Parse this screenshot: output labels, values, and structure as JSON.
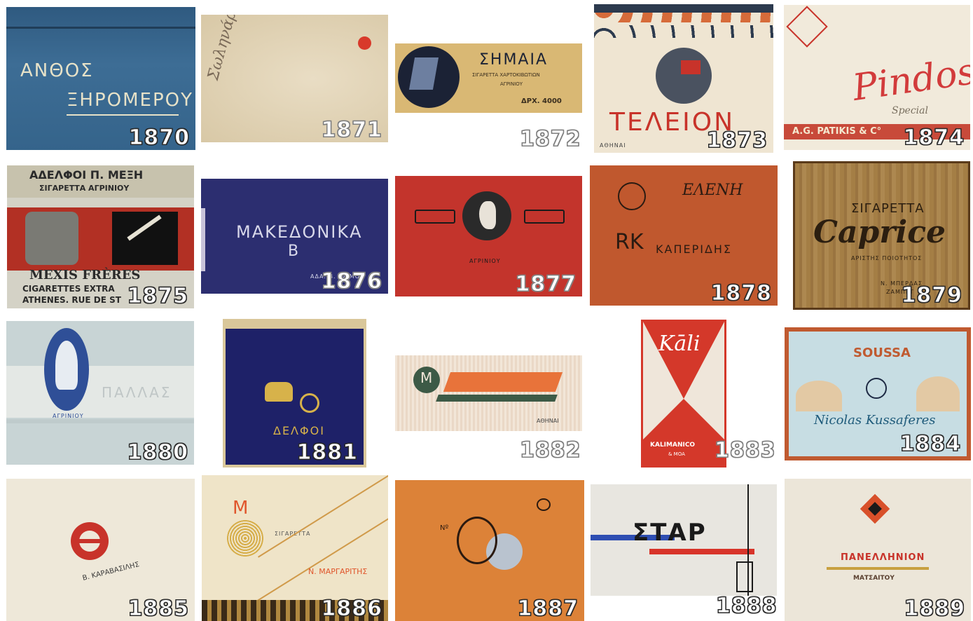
{
  "cards": [
    {
      "year": "1870",
      "lines": [
        "ΑΝΘΟΣ",
        "ΞΗΡΟΜΕΡΟΥ"
      ]
    },
    {
      "year": "1871",
      "lines": [
        "Σωληνάρια"
      ]
    },
    {
      "year": "1872",
      "lines": [
        "ΣΗΜΑΙΑ",
        "ΣΙΓΑΡΕΤΤΑ ΧΑΡΤΟΚΙΒΩΤΙΩΝ",
        "ΑΓΡΙΝΙΟΥ",
        "ΔΡΧ. 4000"
      ]
    },
    {
      "year": "1873",
      "lines": [
        "ΤΕΛΕΙΟΝ",
        "ΑΘΗΝΑΙ"
      ]
    },
    {
      "year": "1874",
      "lines": [
        "Pindos",
        "Special",
        "A.G. PATIKIS & C°"
      ]
    },
    {
      "year": "1875",
      "lines": [
        "ΑΔΕΛΦΟΙ Π. ΜΕΞΗ",
        "ΣΙΓΑΡΕΤΤΑ ΑΓΡΙΝΙΟΥ",
        "MEXIS FRÈRES",
        "CIGARETTES EXTRA",
        "ATHENES. RUE DE ST"
      ]
    },
    {
      "year": "1876",
      "lines": [
        "ΜΑΚΕΔΟΝΙΚΑ",
        "Β",
        "ΑΔΑ. Β. ΤΖΙΜΟΥ"
      ]
    },
    {
      "year": "1877",
      "lines": [
        "ΑΓΡΙΝΙΟΥ"
      ]
    },
    {
      "year": "1878",
      "lines": [
        "ΕΛΕΝΗ",
        "ΚΑΠΕΡΙΔΗΣ"
      ]
    },
    {
      "year": "1879",
      "lines": [
        "ΣΙΓΑΡΕΤΤΑ",
        "Caprice",
        "ΑΡΙΣΤΗΣ ΠΟΙΟΤΗΤΟΣ",
        "Ν. ΜΠΕΡΔΑΣ",
        "ΖΑΜΠΕΤ"
      ]
    },
    {
      "year": "1880",
      "lines": [
        "ΠΑΛΛΑΣ",
        "ΑΓΡΙΝΙΟΥ"
      ]
    },
    {
      "year": "1881",
      "lines": [
        "ΔΕΛΦΟΙ"
      ]
    },
    {
      "year": "1882",
      "lines": [
        "M",
        "ΑΘΗΝΑΙ"
      ]
    },
    {
      "year": "1883",
      "lines": [
        "Kāli",
        "KALIMANICO",
        "& MOA"
      ]
    },
    {
      "year": "1884",
      "lines": [
        "SOUSSA",
        "Nicolas Kussaferes"
      ]
    },
    {
      "year": "1885",
      "lines": [
        "Β. ΚΑΡΑΒΑΣΙΛΗΣ"
      ]
    },
    {
      "year": "1886",
      "lines": [
        "Μ",
        "ΣΙΓΑΡΕΤΤΑ",
        "Ν. ΜΑΡΓΑΡΙΤΗΣ"
      ]
    },
    {
      "year": "1887",
      "lines": [
        "Nº"
      ]
    },
    {
      "year": "1888",
      "lines": [
        "ΣΤΑΡ"
      ]
    },
    {
      "year": "1889",
      "lines": [
        "ΠΑΝΕΛΛΗΝΙΟΝ",
        "ΜΑΤΣΑΙΤΟΥ"
      ]
    }
  ],
  "colors": {
    "number_fill": "#ffffff",
    "number_outline": "#333333"
  }
}
